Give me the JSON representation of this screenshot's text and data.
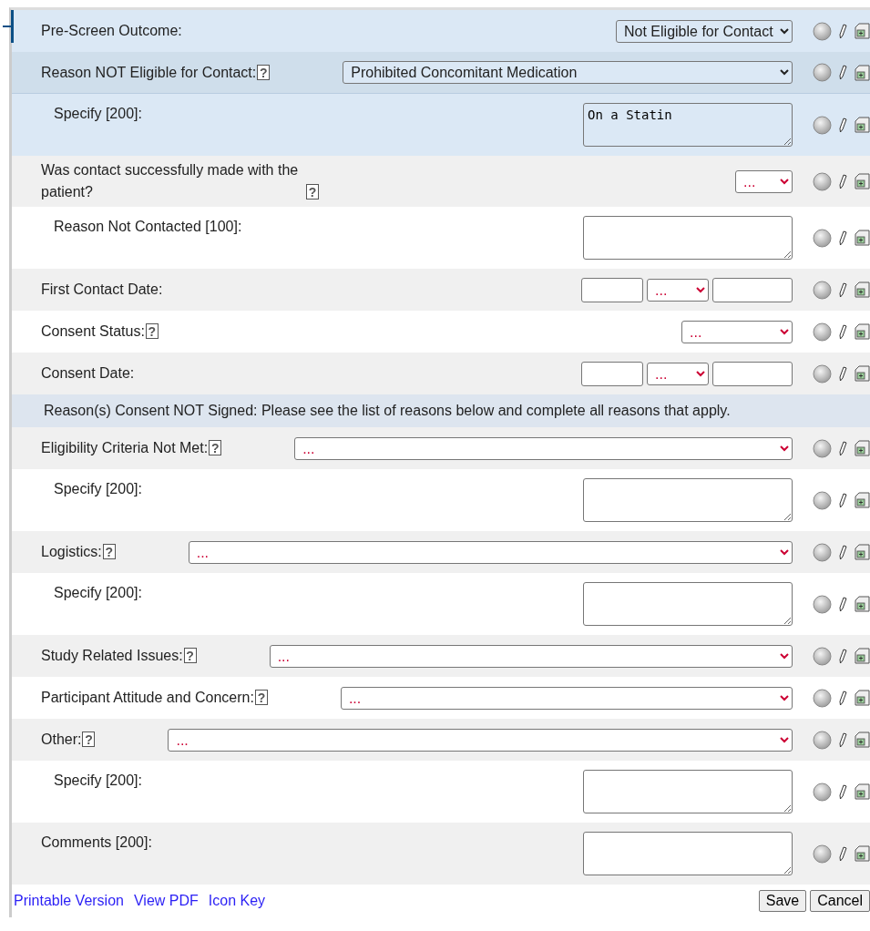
{
  "rows": [
    {
      "kind": "select",
      "label": "Pre-Screen Outcome:",
      "value": "Not Eligible for Contact",
      "wide": false,
      "highlighted": true,
      "selected": false
    },
    {
      "kind": "select",
      "label": "Reason NOT Eligible for Contact:",
      "help": "?",
      "value": "Prohibited Concomitant Medication",
      "wide": true,
      "highlighted": true,
      "selected": true,
      "children": [
        {
          "kind": "textarea",
          "label": "Specify [200]:",
          "value": "On a Statin",
          "highlighted": true,
          "selected": false
        }
      ]
    },
    {
      "kind": "select",
      "label": "Was contact successfully made with the patient?",
      "help": "?",
      "value": "...",
      "wide": false,
      "highlighted": false,
      "selected": false,
      "children": [
        {
          "kind": "textarea",
          "label": "Reason Not Contacted [100]:",
          "highlighted": false,
          "selected": false
        }
      ]
    },
    {
      "kind": "date",
      "label": "First Contact Date:",
      "month": "...",
      "highlighted": false,
      "selected": false
    },
    {
      "kind": "select",
      "label": "Consent Status:",
      "help": "?",
      "value": "...",
      "wide": false,
      "highlighted": false,
      "selected": false
    },
    {
      "kind": "date",
      "label": "Consent Date:",
      "month": "...",
      "highlighted": false,
      "selected": false
    },
    {
      "kind": "header",
      "text": "Reason(s) Consent NOT Signed: Please see the list of reasons below and complete all reasons that apply."
    },
    {
      "kind": "select",
      "label": "Eligibility Criteria Not Met:",
      "help": "?",
      "value": "...",
      "wide": true,
      "highlighted": false,
      "selected": false,
      "children": [
        {
          "kind": "textarea",
          "label": "Specify [200]:",
          "highlighted": false,
          "selected": false
        }
      ]
    },
    {
      "kind": "select",
      "label": "Logistics:",
      "help": "?",
      "value": "...",
      "wide": true,
      "highlighted": false,
      "selected": false,
      "children": [
        {
          "kind": "textarea",
          "label": "Specify [200]:",
          "highlighted": false,
          "selected": false
        }
      ]
    },
    {
      "kind": "select",
      "label": "Study Related Issues:",
      "help": "?",
      "value": "...",
      "wide": true,
      "highlighted": false,
      "selected": false
    },
    {
      "kind": "select",
      "label": "Participant Attitude and Concern:",
      "help": "?",
      "value": "...",
      "wide": true,
      "highlighted": false,
      "selected": false
    },
    {
      "kind": "select",
      "label": "Other:",
      "help": "?",
      "value": "...",
      "wide": true,
      "highlighted": false,
      "selected": false,
      "children": [
        {
          "kind": "textarea",
          "label": "Specify [200]:",
          "highlighted": false,
          "selected": false
        }
      ]
    },
    {
      "kind": "textarea",
      "label": "Comments [200]:",
      "highlighted": false,
      "selected": false
    }
  ],
  "footer": {
    "links": [
      "Printable Version",
      "View PDF",
      "Icon Key"
    ],
    "buttons": [
      "Save",
      "Cancel"
    ]
  }
}
